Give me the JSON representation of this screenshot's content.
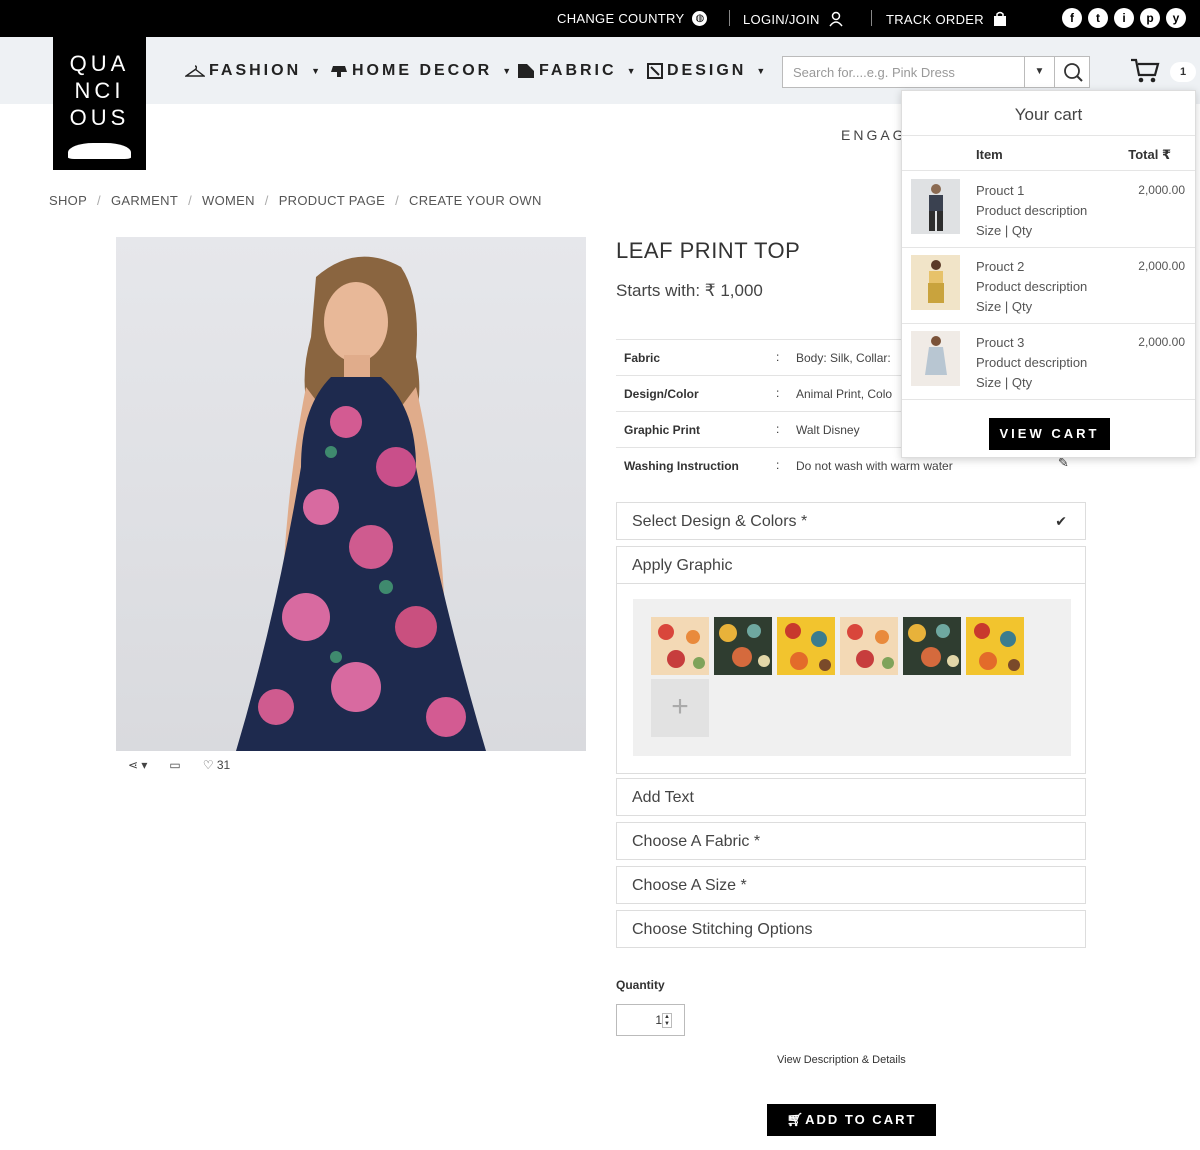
{
  "topbar": {
    "change_country": "CHANGE COUNTRY",
    "login": "LOGIN/JOIN",
    "track_order": "TRACK ORDER",
    "social": [
      "f",
      "t",
      "i",
      "p",
      "y"
    ]
  },
  "logo": {
    "lines": [
      "QUA",
      "NCI",
      "OUS"
    ]
  },
  "nav": [
    {
      "label": "FASHION"
    },
    {
      "label": "HOME DECOR"
    },
    {
      "label": "FABRIC"
    },
    {
      "label": "DESIGN"
    }
  ],
  "search": {
    "placeholder": "Search for....e.g. Pink Dress"
  },
  "cart": {
    "count": "1"
  },
  "engage": "ENGAG",
  "breadcrumb": [
    "SHOP",
    "GARMENT",
    "WOMEN",
    "PRODUCT PAGE",
    "CREATE YOUR OWN"
  ],
  "product": {
    "title": "LEAF PRINT TOP",
    "price": "Starts with: ₹ 1,000",
    "likes": "31"
  },
  "specs": [
    {
      "key": "Fabric",
      "value": "Body: Silk, Collar:"
    },
    {
      "key": "Design/Color",
      "value": "Animal Print, Colo"
    },
    {
      "key": "Graphic Print",
      "value": "Walt Disney"
    },
    {
      "key": "Washing Instruction",
      "value": "Do not wash with warm water"
    }
  ],
  "accordion": {
    "design": "Select Design & Colors *",
    "graphic": "Apply Graphic",
    "text": "Add Text",
    "fabric": "Choose A Fabric *",
    "size": "Choose A Size *",
    "stitching": "Choose Stitching Options"
  },
  "quantity": {
    "label": "Quantity",
    "value": "1"
  },
  "view_description": "View Description & Details",
  "add_to_cart": "ADD TO CART",
  "cart_dropdown": {
    "title": "Your cart",
    "col_item": "Item",
    "col_total": "Total ₹",
    "items": [
      {
        "name": "Prouct 1",
        "desc": "Product description",
        "meta": "Size  |  Qty",
        "price": "2,000.00"
      },
      {
        "name": "Prouct 2",
        "desc": "Product description",
        "meta": "Size  |  Qty",
        "price": "2,000.00"
      },
      {
        "name": "Prouct 3",
        "desc": "Product description",
        "meta": "Size  |  Qty",
        "price": "2,000.00"
      }
    ],
    "view_cart": "VIEW CART"
  },
  "colors": {
    "accent": "#000000",
    "band": "#eef1f4"
  }
}
